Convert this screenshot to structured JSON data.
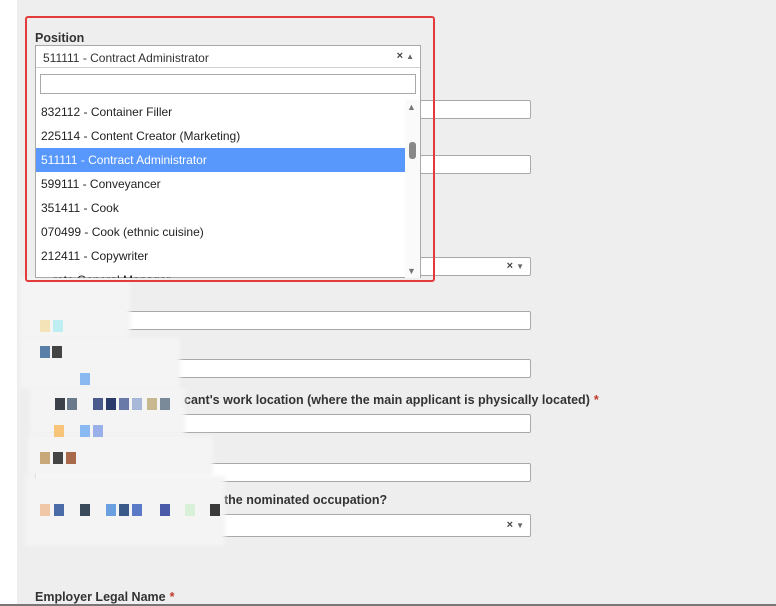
{
  "position_field": {
    "label": "Position",
    "selected_value": "511111 - Contract Administrator",
    "clear_glyph": "×",
    "search_placeholder": "",
    "options": [
      {
        "text": "832112 - Container Filler",
        "highlighted": false
      },
      {
        "text": "225114 - Content Creator (Marketing)",
        "highlighted": false
      },
      {
        "text": "511111 - Contract Administrator",
        "highlighted": true
      },
      {
        "text": "599111 - Conveyancer",
        "highlighted": false
      },
      {
        "text": "351411 - Cook",
        "highlighted": false
      },
      {
        "text": "070499 - Cook (ethnic cuisine)",
        "highlighted": false
      },
      {
        "text": "212411 - Copywriter",
        "highlighted": false
      },
      {
        "text": "…rate General Manager",
        "highlighted": false
      }
    ]
  },
  "work_location_label_fragment": "cant's work location (where the main applicant is physically located)",
  "occupation_label_fragment": "the nominated occupation?",
  "employer_label": "Employer Legal Name",
  "required_mark": "*",
  "clear_glyph": "×",
  "colors": {
    "highlight_border": "#e33b3b",
    "option_highlight": "#5897fb",
    "required": "#c0392b",
    "panel_bg": "#eeeeee"
  }
}
